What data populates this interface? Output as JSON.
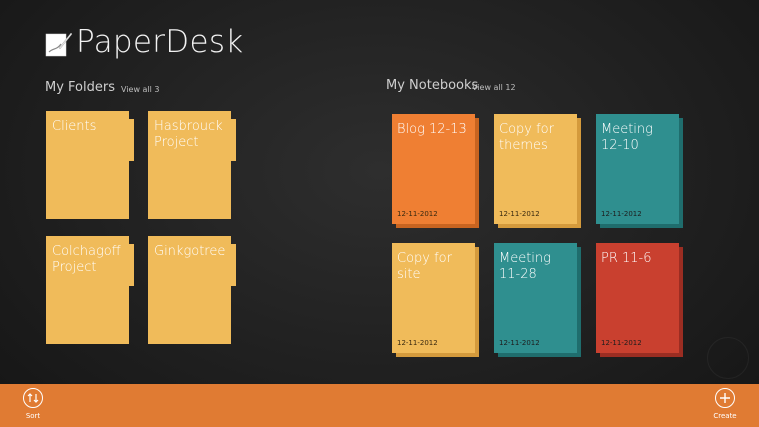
{
  "app": {
    "title": "PaperDesk"
  },
  "folders_section": {
    "title": "My Folders",
    "view_all": "View all 3",
    "items": [
      {
        "label": "Clients"
      },
      {
        "label": "Hasbrouck Project"
      },
      {
        "label": "Colchagoff Project"
      },
      {
        "label": "Ginkgotree"
      }
    ]
  },
  "notebooks_section": {
    "title": "My Notebooks",
    "view_all": "View all 12",
    "items": [
      {
        "title": "Blog 12-13",
        "date": "12-11-2012",
        "color": "#ef7f33"
      },
      {
        "title": "Copy for themes",
        "date": "12-11-2012",
        "color": "#f0bb5a"
      },
      {
        "title": "Meeting 12-10",
        "date": "12-11-2012",
        "color": "#2f8f8f"
      },
      {
        "title": "Copy for site",
        "date": "12-11-2012",
        "color": "#f0bb5a"
      },
      {
        "title": "Meeting 11-28",
        "date": "12-11-2012",
        "color": "#2f8f8f"
      },
      {
        "title": "PR 11-6",
        "date": "12-11-2012",
        "color": "#c9402f"
      }
    ]
  },
  "appbar": {
    "sort_label": "Sort",
    "create_label": "Create",
    "color": "#e07b33"
  }
}
